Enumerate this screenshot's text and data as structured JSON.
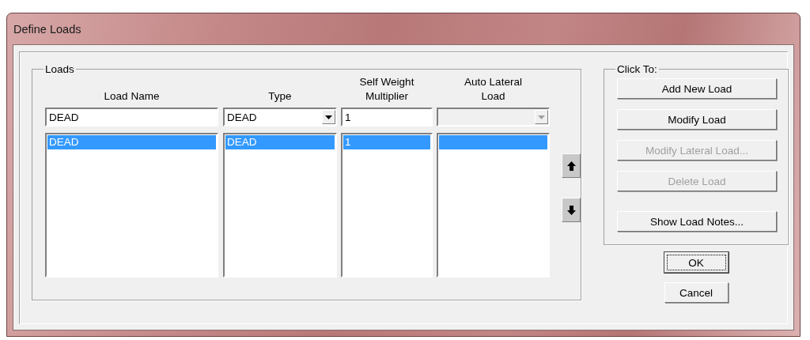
{
  "window": {
    "title": "Define Loads"
  },
  "loads": {
    "label": "Loads",
    "columns": [
      {
        "header": "Load Name"
      },
      {
        "header": "Type"
      },
      {
        "header": "Self Weight Multiplier"
      },
      {
        "header": "Auto Lateral Load"
      }
    ],
    "inputs": {
      "load_name": "DEAD",
      "type": "DEAD",
      "multiplier": "1",
      "auto_lateral_disabled": true
    },
    "rows": [
      {
        "load_name": "DEAD",
        "type": "DEAD",
        "multiplier": "1",
        "selected": true
      }
    ]
  },
  "actions": {
    "label": "Click To:",
    "button_groups": [
      [
        {
          "label": "Add New Load",
          "disabled": false
        },
        {
          "label": "Modify Load",
          "disabled": false
        },
        {
          "label": "Modify Lateral Load...",
          "disabled": true
        },
        {
          "label": "Delete Load",
          "disabled": true
        }
      ],
      [
        {
          "label": "Show Load Notes...",
          "disabled": false
        }
      ]
    ]
  },
  "dialog_buttons": [
    {
      "label": "OK",
      "default": true
    },
    {
      "label": "Cancel",
      "default": false
    }
  ]
}
